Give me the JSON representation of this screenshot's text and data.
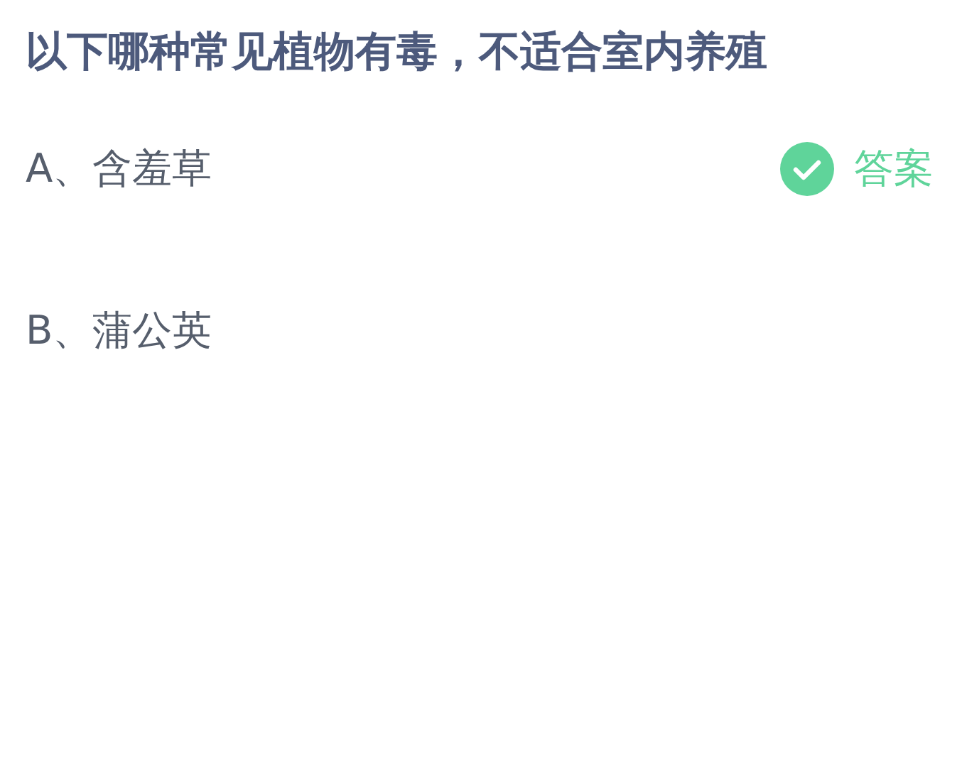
{
  "question": "以下哪种常见植物有毒，不适合室内养殖",
  "options": [
    {
      "label": "A、含羞草",
      "correct": true,
      "answer_label": "答案"
    },
    {
      "label": "B、蒲公英",
      "correct": false
    }
  ]
}
